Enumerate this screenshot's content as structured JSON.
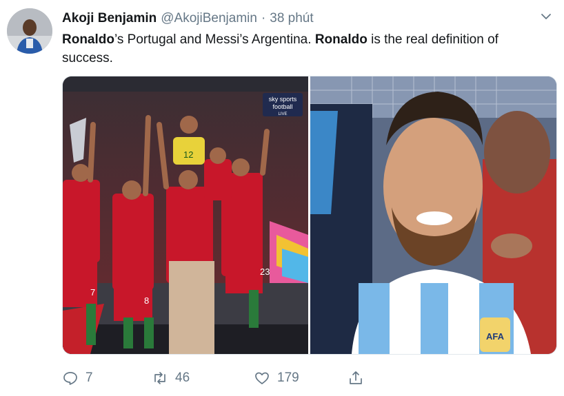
{
  "tweet": {
    "author_name": "Akoji Benjamin",
    "handle": "@AkojiBenjamin",
    "separator": "·",
    "time": "38 phút",
    "text_parts": [
      "Ronaldo",
      "’s Portugal and Messi’s Argentina. ",
      "Ronaldo",
      " is the real definition of success."
    ],
    "media": [
      {
        "name": "portugal-celebration-photo",
        "caption_logo_top": "sky sports",
        "caption_logo_mid": "football",
        "caption_logo_bottom": "LIVE",
        "shirt_numbers": [
          "12",
          "7",
          "8",
          "23"
        ]
      },
      {
        "name": "messi-argentina-photo",
        "badge_text": "AFA"
      }
    ],
    "metrics": {
      "replies": "7",
      "retweets": "46",
      "likes": "179"
    }
  },
  "colors": {
    "text": "#14171a",
    "secondary": "#657786",
    "border": "#e1e8ed"
  },
  "icons": [
    "chevron-down-icon",
    "reply-icon",
    "retweet-icon",
    "like-icon",
    "share-icon"
  ]
}
